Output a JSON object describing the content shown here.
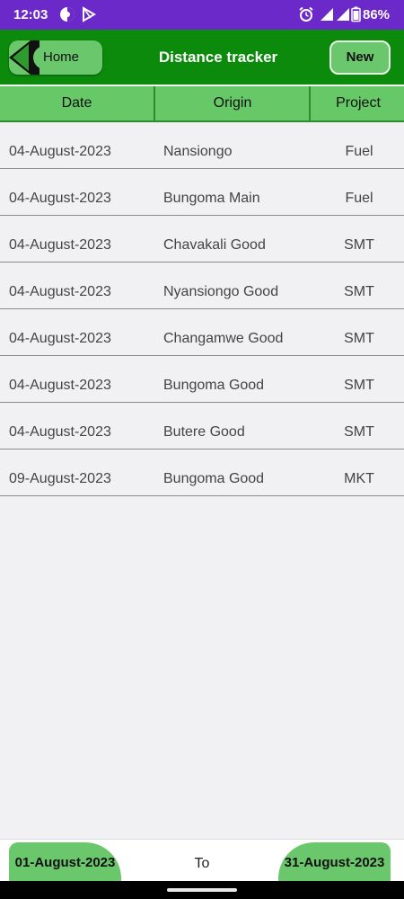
{
  "status_bar": {
    "time": "12:03",
    "battery": "86%"
  },
  "toolbar": {
    "home_label": "Home",
    "title": "Distance tracker",
    "new_label": "New"
  },
  "table": {
    "columns": [
      "Date",
      "Origin",
      "Project"
    ],
    "rows": [
      {
        "date": "04-August-2023",
        "origin": "Nansiongo",
        "project": "Fuel"
      },
      {
        "date": "04-August-2023",
        "origin": "Bungoma Main",
        "project": "Fuel"
      },
      {
        "date": "04-August-2023",
        "origin": "Chavakali Good",
        "project": "SMT"
      },
      {
        "date": "04-August-2023",
        "origin": "Nyansiongo Good",
        "project": "SMT"
      },
      {
        "date": "04-August-2023",
        "origin": "Changamwe Good",
        "project": "SMT"
      },
      {
        "date": "04-August-2023",
        "origin": "Bungoma Good",
        "project": "SMT"
      },
      {
        "date": "04-August-2023",
        "origin": "Butere Good",
        "project": "SMT"
      },
      {
        "date": "09-August-2023",
        "origin": "Bungoma Good",
        "project": "MKT"
      }
    ]
  },
  "footer": {
    "from_date": "01-August-2023",
    "to_label": "To",
    "to_date": "31-August-2023"
  },
  "colors": {
    "status_bar": "#6b29c9",
    "toolbar": "#0b8a0b",
    "accent": "#6bc76b",
    "header": "#66c867"
  }
}
